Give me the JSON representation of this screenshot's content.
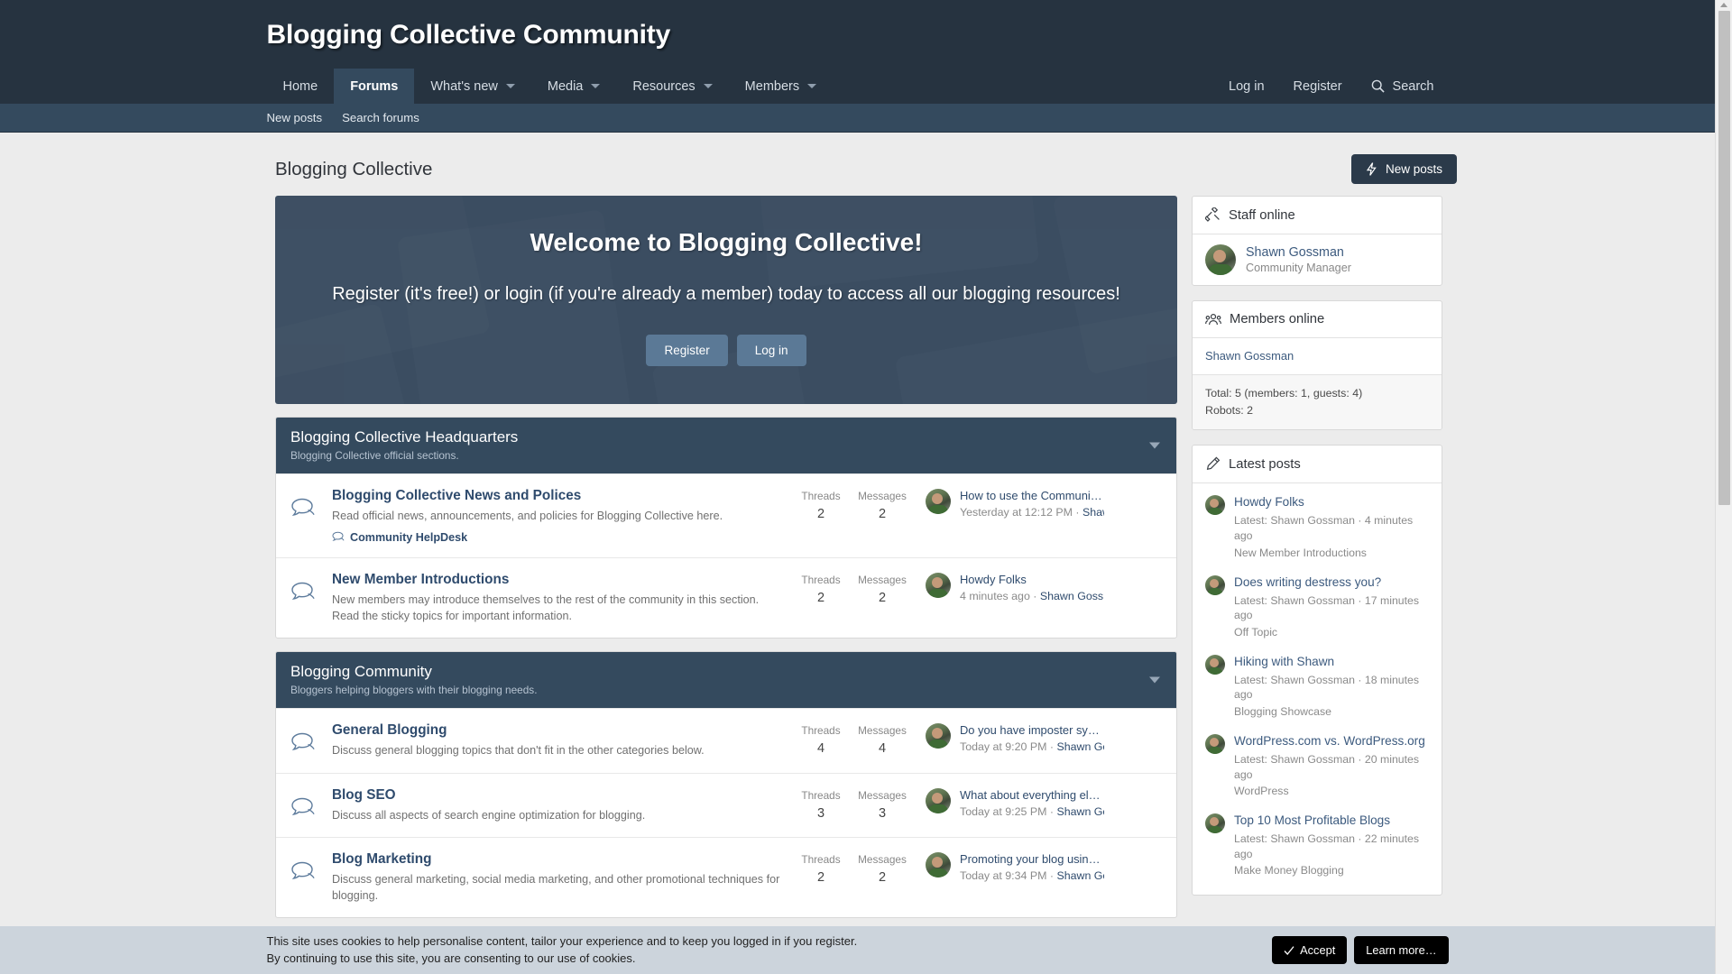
{
  "colors": {
    "header_bg": "#263340",
    "subnav_bg": "#344a5e",
    "page_bg": "#ececec",
    "link": "#2f4b6d",
    "welcome_bg": "#3b4d61",
    "welcome_btn": "#5b7996",
    "cookie_bg": "#ccd4dc"
  },
  "header": {
    "site_title": "Blogging Collective Community"
  },
  "nav": {
    "items": [
      {
        "label": "Home",
        "has_caret": false,
        "active": false
      },
      {
        "label": "Forums",
        "has_caret": false,
        "active": true
      },
      {
        "label": "What's new",
        "has_caret": true,
        "active": false
      },
      {
        "label": "Media",
        "has_caret": true,
        "active": false
      },
      {
        "label": "Resources",
        "has_caret": true,
        "active": false
      },
      {
        "label": "Members",
        "has_caret": true,
        "active": false
      }
    ],
    "right": [
      {
        "label": "Log in",
        "icon": ""
      },
      {
        "label": "Register",
        "icon": ""
      },
      {
        "label": "Search",
        "icon": "search-icon"
      }
    ]
  },
  "subnav": {
    "items": [
      "New posts",
      "Search forums"
    ]
  },
  "page": {
    "title": "Blogging Collective",
    "new_posts_button": "New posts",
    "new_posts_icon": "lightning-bolt-icon"
  },
  "welcome": {
    "heading": "Welcome to Blogging Collective!",
    "body": "Register (it's free!) or login (if you're already a member) today to access all our blogging resources!",
    "register_label": "Register",
    "login_label": "Log in"
  },
  "column_headers": {
    "threads": "Threads",
    "messages": "Messages"
  },
  "categories": [
    {
      "title": "Blogging Collective Headquarters",
      "description": "Blogging Collective official sections.",
      "forums": [
        {
          "name": "Blogging Collective News and Polices",
          "description": "Read official news, announcements, and policies for Blogging Collective here.",
          "subforums": [
            "Community HelpDesk"
          ],
          "threads": "2",
          "messages": "2",
          "last_title": "How to use the Community HelpDesk!",
          "last_date": "Yesterday at 12:12 PM",
          "last_user": "Shawn Gossma"
        },
        {
          "name": "New Member Introductions",
          "description": "New members may introduce themselves to the rest of the community in this section. Read the sticky topics for important information.",
          "subforums": [],
          "threads": "2",
          "messages": "2",
          "last_title": "Howdy Folks",
          "last_date": "4 minutes ago",
          "last_user": "Shawn Gossman"
        }
      ]
    },
    {
      "title": "Blogging Community",
      "description": "Bloggers helping bloggers with their blogging needs.",
      "forums": [
        {
          "name": "General Blogging",
          "description": "Discuss general blogging topics that don't fit in the other categories below.",
          "subforums": [],
          "threads": "4",
          "messages": "4",
          "last_title": "Do you have imposter syndrome?",
          "last_date": "Today at 9:20 PM",
          "last_user": "Shawn Gossman"
        },
        {
          "name": "Blog SEO",
          "description": "Discuss all aspects of search engine optimization for blogging.",
          "subforums": [],
          "threads": "3",
          "messages": "3",
          "last_title": "What about everything else besides …",
          "last_date": "Today at 9:25 PM",
          "last_user": "Shawn Gossman"
        },
        {
          "name": "Blog Marketing",
          "description": "Discuss general marketing, social media marketing, and other promotional techniques for blogging.",
          "subforums": [],
          "threads": "2",
          "messages": "2",
          "last_title": "Promoting your blog using Guerilla M…",
          "last_date": "Today at 9:34 PM",
          "last_user": "Shawn Gossman"
        }
      ]
    }
  ],
  "sidebar": {
    "staff_online": {
      "title": "Staff online",
      "icon": "gavel-icon",
      "members": [
        {
          "name": "Shawn Gossman",
          "role": "Community Manager"
        }
      ]
    },
    "members_online": {
      "title": "Members online",
      "icon": "users-icon",
      "members": [
        "Shawn Gossman"
      ],
      "total_line": "Total: 5 (members: 1, guests: 4)",
      "robots_line": "Robots: 2"
    },
    "latest_posts": {
      "title": "Latest posts",
      "icon": "pencil-icon",
      "items": [
        {
          "title": "Howdy Folks",
          "meta": "Latest: Shawn Gossman · 4 minutes ago",
          "forum": "New Member Introductions"
        },
        {
          "title": "Does writing destress you?",
          "meta": "Latest: Shawn Gossman · 17 minutes ago",
          "forum": "Off Topic"
        },
        {
          "title": "Hiking with Shawn",
          "meta": "Latest: Shawn Gossman · 18 minutes ago",
          "forum": "Blogging Showcase"
        },
        {
          "title": "WordPress.com vs. WordPress.org",
          "meta": "Latest: Shawn Gossman · 20 minutes ago",
          "forum": "WordPress"
        },
        {
          "title": "Top 10 Most Profitable Blogs",
          "meta": "Latest: Shawn Gossman · 22 minutes ago",
          "forum": "Make Money Blogging"
        }
      ]
    }
  },
  "cookie_notice": {
    "line1": "This site uses cookies to help personalise content, tailor your experience and to keep you logged in if you register.",
    "line2": "By continuing to use this site, you are consenting to our use of cookies.",
    "accept_label": "Accept",
    "accept_icon": "check-icon",
    "learn_more_label": "Learn more…"
  }
}
